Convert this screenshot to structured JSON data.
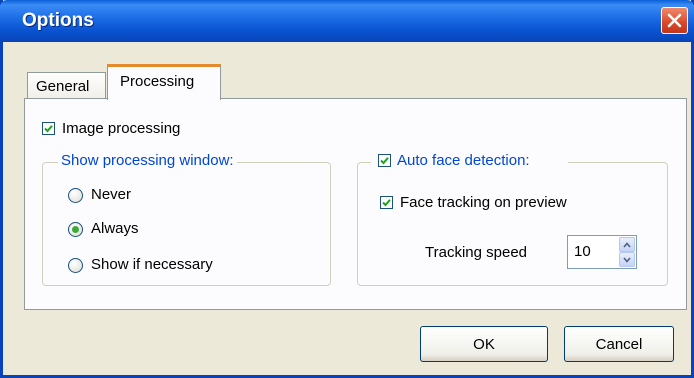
{
  "window": {
    "title": "Options"
  },
  "tabs": [
    {
      "label": "General",
      "active": false
    },
    {
      "label": "Processing",
      "active": true
    }
  ],
  "image_processing": {
    "label": "Image processing",
    "checked": true
  },
  "show_processing_window": {
    "legend": "Show processing window:",
    "options": [
      {
        "label": "Never",
        "selected": false
      },
      {
        "label": "Always",
        "selected": true
      },
      {
        "label": "Show if necessary",
        "selected": false
      }
    ]
  },
  "auto_face_detection": {
    "label": "Auto face detection:",
    "checked": true
  },
  "face_tracking": {
    "label": "Face tracking on preview",
    "checked": true
  },
  "tracking_speed": {
    "label": "Tracking speed",
    "value": "10"
  },
  "buttons": {
    "ok": "OK",
    "cancel": "Cancel"
  },
  "colors": {
    "title_bar": "#0a55d2",
    "accent_tab": "#e68b2c",
    "legend_text": "#0046d5",
    "check_mark": "#21a121"
  },
  "icons": {
    "close": "close-icon",
    "spin_up": "chevron-up-icon",
    "spin_down": "chevron-down-icon"
  }
}
